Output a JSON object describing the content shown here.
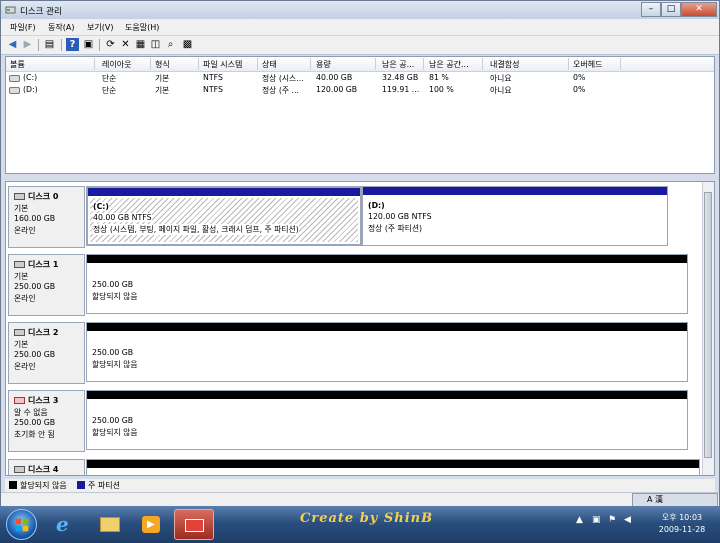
{
  "window": {
    "title": "디스크 관리"
  },
  "menu": [
    "파일(F)",
    "동작(A)",
    "보기(V)",
    "도움말(H)"
  ],
  "toolbar_icons": [
    "back-arrow-icon",
    "forward-arrow-icon",
    "console-tree-icon",
    "help-icon",
    "properties-icon",
    "refresh-icon",
    "delete-icon",
    "connect-drive-icon",
    "open-folder-icon",
    "search-icon",
    "settings-icon"
  ],
  "volume_list": {
    "columns": [
      "볼륨",
      "레이아웃",
      "형식",
      "파일 시스템",
      "상태",
      "용량",
      "남은 공...",
      "남은 공간...",
      "내결함성",
      "오버헤드"
    ],
    "rows": [
      [
        "(C:)",
        "단순",
        "기본",
        "NTFS",
        "정상 (시스...",
        "40.00 GB",
        "32.48 GB",
        "81 %",
        "아니요",
        "0%"
      ],
      [
        "(D:)",
        "단순",
        "기본",
        "NTFS",
        "정상 (주 ...",
        "120.00 GB",
        "119.91 ...",
        "100 %",
        "아니요",
        "0%"
      ]
    ]
  },
  "disks": [
    {
      "name": "디스크 0",
      "type": "기본",
      "size": "160.00 GB",
      "status": "온라인",
      "partitions": [
        {
          "title": "(C:)",
          "size": "40.00 GB NTFS",
          "state": "정상 (시스템, 부팅, 페이지 파일, 활성, 크래시 덤프, 주 파티션)"
        },
        {
          "title": "(D:)",
          "size": "120.00 GB NTFS",
          "state": "정상 (주 파티션)"
        }
      ]
    },
    {
      "name": "디스크 1",
      "type": "기본",
      "size": "250.00 GB",
      "status": "온라인",
      "partitions": [
        {
          "size": "250.00 GB",
          "state": "할당되지 않음"
        }
      ]
    },
    {
      "name": "디스크 2",
      "type": "기본",
      "size": "250.00 GB",
      "status": "온라인",
      "partitions": [
        {
          "size": "250.00 GB",
          "state": "할당되지 않음"
        }
      ]
    },
    {
      "name": "디스크 3",
      "type": "알 수 없음",
      "size": "250.00 GB",
      "status": "초기화 안 됨",
      "partitions": [
        {
          "size": "250.00 GB",
          "state": "할당되지 않음"
        }
      ]
    },
    {
      "name": "디스크 4",
      "type": "기본",
      "size": "",
      "status": "",
      "partitions": []
    }
  ],
  "legend": {
    "unallocated": "할당되지 않음",
    "primary": "주 파티션"
  },
  "colors": {
    "unallocated": "#000000",
    "primary": "#1a1aa0",
    "titlebar": "#c3d1e3"
  },
  "taskbar": {
    "watermark": "Create by ShinB",
    "clock_time": "오후 10:03",
    "clock_date": "2009-11-28",
    "language_indicator": "A 漢"
  }
}
